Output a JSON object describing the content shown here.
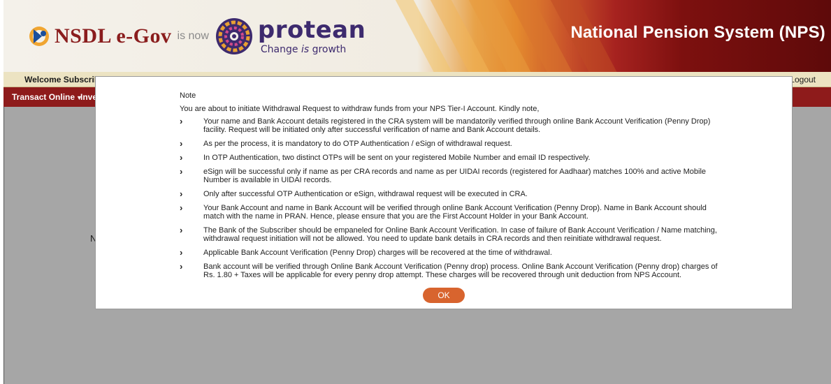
{
  "header": {
    "brand_nsdl": "NSDL e-Gov",
    "brand_isnow": "is now",
    "brand_protean": "protean",
    "tagline_prefix": "Change ",
    "tagline_is": "is",
    "tagline_suffix": " growth",
    "system_title": "National Pension System (NPS)"
  },
  "welcome_bar": {
    "welcome_text": "Welcome Subscribe",
    "logout_label": "Logout"
  },
  "menu": {
    "items": [
      "Transact Online",
      "Inve"
    ]
  },
  "page": {
    "partial_text": "N"
  },
  "modal": {
    "title": "Note",
    "intro": "You are about to initiate Withdrawal Request to withdraw funds from your NPS Tier-I Account. Kindly note,",
    "bullets": [
      "Your name and Bank Account details registered in the CRA system will be mandatorily verified through online Bank Account Verification (Penny Drop) facility. Request will be initiated only after successful verification of name and Bank Account details.",
      "As per the process, it is mandatory to do OTP Authentication / eSign of withdrawal request.",
      "In OTP Authentication, two distinct OTPs will be sent on your registered Mobile Number and email ID respectively.",
      "eSign will be successful only if name as per CRA records and name as per UIDAI records (registered for Aadhaar) matches 100% and active Mobile Number is available in UIDAI records.",
      "Only after successful OTP Authentication or eSign, withdrawal request will be executed in CRA.",
      "Your Bank Account and name in Bank Account will be verified through online Bank Account Verification (Penny Drop). Name in Bank Account should match with the name in PRAN. Hence, please ensure that you are the First Account Holder in your Bank Account.",
      "The Bank of the Subscriber should be empaneled for Online Bank Account Verification. In case of failure of Bank Account Verification / Name matching, withdrawal request initiation will not be allowed. You need to update bank details in CRA records and then reinitiate withdrawal request.",
      "Applicable Bank Account Verification (Penny Drop) charges will be recovered at the time of withdrawal.",
      "Bank account will be verified through Online Bank Account Verification (Penny drop) process. Online Bank Account Verification (Penny drop) charges of Rs. 1.80 + Taxes will be applicable for every penny drop attempt. These charges will be recovered through unit deduction from NPS Account."
    ],
    "bullet_icon": "chevron-right-icon",
    "ok_label": "OK"
  },
  "colors": {
    "menu_bar": "#8e1b1b",
    "welcome_bar": "#ece3c2",
    "overlay": "#a6a6a6",
    "ok_button": "#d8642e",
    "brand_maroon": "#8a1d1d",
    "protean_purple": "#3d2a6e"
  }
}
